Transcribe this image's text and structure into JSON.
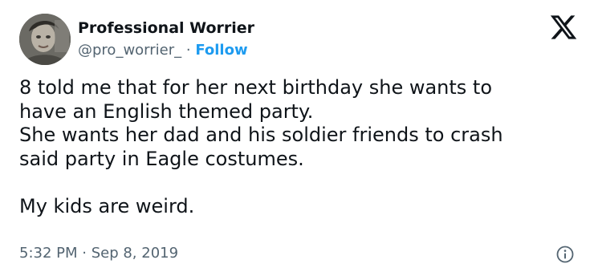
{
  "author": {
    "name": "Professional Worrier",
    "handle": "@pro_worrier_",
    "separator": " · ",
    "follow_label": "Follow"
  },
  "tweet": {
    "text": "8 told me that for her next birthday she wants to\nhave an English themed party.\nShe wants her dad and his soldier friends to crash\nsaid party in Eagle costumes.\n\nMy kids are weird.",
    "time": "5:32 PM",
    "date_separator": " · ",
    "date": "Sep 8, 2019"
  },
  "icons": {
    "brand": "x-logo-icon",
    "info": "info-icon"
  },
  "colors": {
    "text": "#0f1419",
    "secondary": "#536471",
    "accent": "#1d9bf0"
  }
}
